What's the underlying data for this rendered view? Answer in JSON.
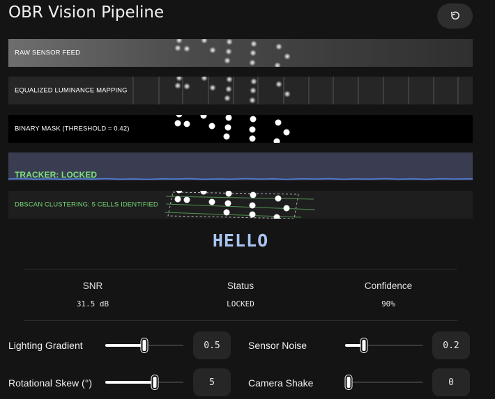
{
  "app": {
    "title": "OBR Vision Pipeline"
  },
  "toolbar": {
    "reset_icon": "refresh-icon"
  },
  "pipeline": {
    "raw_label": "RAW SENSOR FEED",
    "equalized_label": "EQUALIZED LUMINANCE MAPPING",
    "binary_label": "BINARY MASK (THRESHOLD = 0.42)",
    "tracker_label": "TRACKER: LOCKED",
    "dbscan_label": "DBSCAN CLUSTERING: 5 CELLS IDENTIFIED"
  },
  "decoded_text": "HELLO",
  "stats": {
    "snr_label": "SNR",
    "snr_value": "31.5 dB",
    "status_label": "Status",
    "status_value": "LOCKED",
    "confidence_label": "Confidence",
    "confidence_value": "90%"
  },
  "controls": {
    "lighting_gradient": {
      "label": "Lighting Gradient",
      "value": "0.5",
      "fraction": 0.5
    },
    "sensor_noise": {
      "label": "Sensor Noise",
      "value": "0.2",
      "fraction": 0.22
    },
    "rotational_skew": {
      "label": "Rotational Skew (°)",
      "value": "5",
      "fraction": 0.65
    },
    "camera_shake": {
      "label": "Camera Shake",
      "value": "0",
      "fraction": 0.0
    }
  },
  "colors": {
    "accent_green": "#7ce07a",
    "decoded_blue": "#a9c4f2",
    "waveform_blue": "#4f7fd6"
  }
}
